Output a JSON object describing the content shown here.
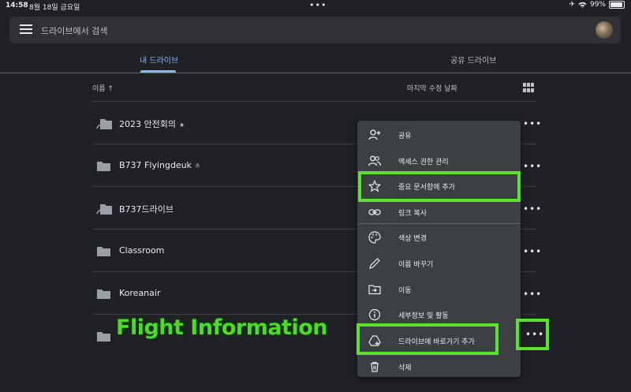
{
  "status": {
    "time": "14:58",
    "date": "8월 18일 금요일",
    "battery": "99%"
  },
  "search": {
    "placeholder": "드라이브에서 검색"
  },
  "tabs": [
    {
      "label": "내 드라이브"
    },
    {
      "label": "공유 드라이브"
    }
  ],
  "list_header": {
    "name": "이름 ↑",
    "modified": "마지막 수정 날짜"
  },
  "files": [
    {
      "name": "2023 안전회의",
      "starred": "★"
    },
    {
      "name": "B737 Flyingdeuk",
      "badge": "≗"
    },
    {
      "name": "B737드라이브"
    },
    {
      "name": "Classroom"
    },
    {
      "name": "Koreanair"
    },
    {
      "name": "Flight Information"
    }
  ],
  "context_menu": [
    {
      "label": "공유",
      "icon": "person-add-icon"
    },
    {
      "label": "액세스 권한 관리",
      "icon": "people-icon"
    },
    {
      "label": "중요 문서함에 추가",
      "icon": "star-outline-icon"
    },
    {
      "label": "링크 복사",
      "icon": "link-icon"
    },
    {
      "label": "색상 변경",
      "icon": "palette-icon"
    },
    {
      "label": "이름 바꾸기",
      "icon": "pencil-icon"
    },
    {
      "label": "이동",
      "icon": "move-folder-icon"
    },
    {
      "label": "세부정보 및 활동",
      "icon": "info-icon"
    },
    {
      "label": "드라이브에 바로가기 추가",
      "icon": "add-shortcut-icon"
    },
    {
      "label": "삭제",
      "icon": "trash-icon"
    }
  ],
  "overlay_text": "Flight Information",
  "colors": {
    "background": "#202124",
    "accent": "#8ab4f8",
    "highlight": "#5ce12f"
  }
}
